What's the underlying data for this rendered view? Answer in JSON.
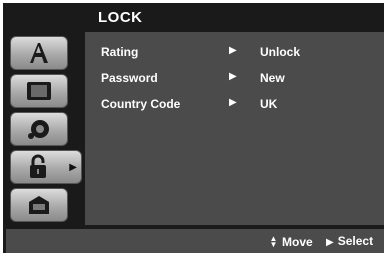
{
  "header": {
    "title": "LOCK"
  },
  "sidebar": {
    "tabs": [
      {
        "icon": "language-a-icon"
      },
      {
        "icon": "display-screen-icon"
      },
      {
        "icon": "audio-speaker-icon"
      },
      {
        "icon": "padlock-icon",
        "active": true,
        "arrow": "▶"
      },
      {
        "icon": "toolbox-icon"
      }
    ]
  },
  "menu": {
    "rows": [
      {
        "label": "Rating",
        "arrow": "▶",
        "value": "Unlock"
      },
      {
        "label": "Password",
        "arrow": "▶",
        "value": "New"
      },
      {
        "label": "Country Code",
        "arrow": "▶",
        "value": "UK"
      }
    ]
  },
  "footer": {
    "move_icon": "▲▼",
    "move_label": "Move",
    "select_icon": "▶",
    "select_label": "Select"
  },
  "colors": {
    "background": "#1a1a1a",
    "panel": "#4b4b4b",
    "text": "#ffffff"
  }
}
